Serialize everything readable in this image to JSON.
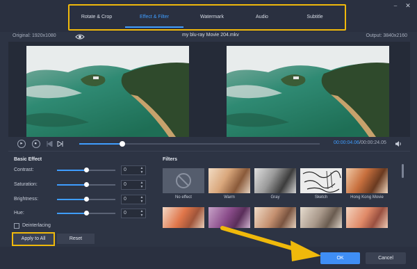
{
  "tabs": [
    {
      "label": "Rotate & Crop",
      "active": false
    },
    {
      "label": "Effect & Filter",
      "active": true
    },
    {
      "label": "Watermark",
      "active": false
    },
    {
      "label": "Audio",
      "active": false
    },
    {
      "label": "Subtitle",
      "active": false
    }
  ],
  "window": {
    "minimize": "⎯",
    "close": "✕"
  },
  "info": {
    "original": "Original: 1920x1080",
    "file_name": "my blu-ray Movie 204.mkv",
    "output": "Output: 3840x2160"
  },
  "playback": {
    "current_time": "00:00:04.06",
    "separator": "/",
    "total_time": "00:00:24.05",
    "progress": 0.18
  },
  "basic_effect": {
    "title": "Basic Effect",
    "sliders": [
      {
        "label": "Contrast:",
        "value": "0",
        "position": 0.5
      },
      {
        "label": "Saturation:",
        "value": "0",
        "position": 0.5
      },
      {
        "label": "Brightness:",
        "value": "0",
        "position": 0.5
      },
      {
        "label": "Hue:",
        "value": "0",
        "position": 0.5
      }
    ],
    "deinterlacing": "Deinterlacing",
    "apply_all": "Apply to All",
    "reset": "Reset"
  },
  "filters": {
    "title": "Filters",
    "row1": [
      "No effect",
      "Warm",
      "Gray",
      "Sketch",
      "Hong Kong Movie"
    ]
  },
  "footer": {
    "ok": "OK",
    "cancel": "Cancel"
  },
  "colors": {
    "accent": "#3f9dff",
    "highlight": "#f0b90b",
    "ok_button": "#3f8ef5"
  }
}
